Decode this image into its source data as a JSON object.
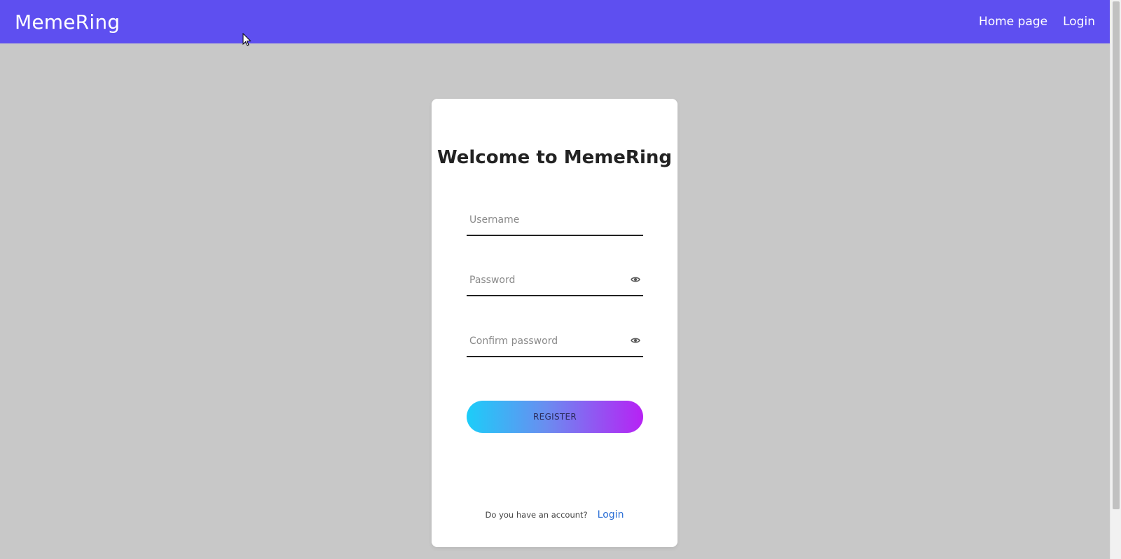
{
  "navbar": {
    "brand": "MemeRing",
    "links": [
      {
        "label": "Home page"
      },
      {
        "label": "Login"
      }
    ],
    "color": "#5e4ff0"
  },
  "card": {
    "title": "Welcome to MemeRing",
    "username_placeholder": "Username",
    "password_placeholder": "Password",
    "confirm_placeholder": "Confirm password",
    "register_label": "REGISTER",
    "footer_text": "Do you have an account?",
    "footer_link": "Login"
  },
  "icons": {
    "password_toggle": "eye-icon",
    "confirm_toggle": "eye-icon"
  }
}
